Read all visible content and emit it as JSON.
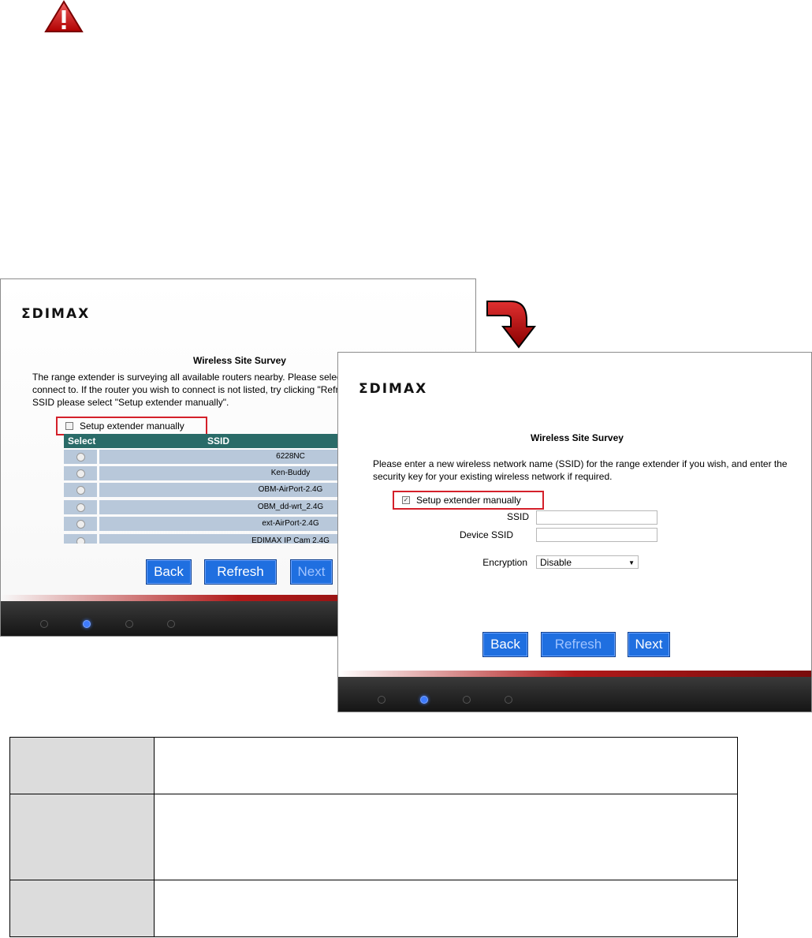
{
  "left_screen": {
    "logo": "ΣDIMAX",
    "title": "Wireless Site Survey",
    "desc_lines": [
      "The range extender is surveying all available routers nearby. Please select",
      "connect to. If the router you wish to connect is not listed, try clicking \"Refres",
      "SSID please select \"Setup extender manually\"."
    ],
    "checkbox_label": "Setup extender manually",
    "checkbox_checked": false,
    "table": {
      "headers": [
        "Select",
        "SSID"
      ],
      "rows": [
        "6228NC",
        "Ken-Buddy",
        "OBM-AirPort-2.4G",
        "OBM_dd-wrt_2.4G",
        "ext-AirPort-2.4G",
        "EDIMAX IP Cam 2.4G"
      ]
    },
    "buttons": {
      "back": "Back",
      "refresh": "Refresh",
      "next": "Next"
    }
  },
  "right_screen": {
    "logo": "ΣDIMAX",
    "title": "Wireless Site Survey",
    "desc_lines": [
      "Please enter a new wireless network name (SSID) for the range extender if you wish, and enter the",
      "security key for your existing wireless network if required."
    ],
    "checkbox_label": "Setup extender manually",
    "checkbox_checked": true,
    "fields": {
      "ssid_label": "SSID",
      "ssid_value": "",
      "device_ssid_label": "Device SSID",
      "device_ssid_value": "",
      "encryption_label": "Encryption",
      "encryption_value": "Disable"
    },
    "buttons": {
      "back": "Back",
      "refresh": "Refresh",
      "next": "Next"
    }
  },
  "colors": {
    "accent_button": "#1f6fe0",
    "highlight_box": "#d4202a",
    "table_header": "#2a6b68",
    "led_active": "#3e7bff"
  },
  "icons": [
    "warning-icon",
    "arrow-down-curved-icon"
  ],
  "led_indicators": {
    "count": 4,
    "active_index": 1
  }
}
